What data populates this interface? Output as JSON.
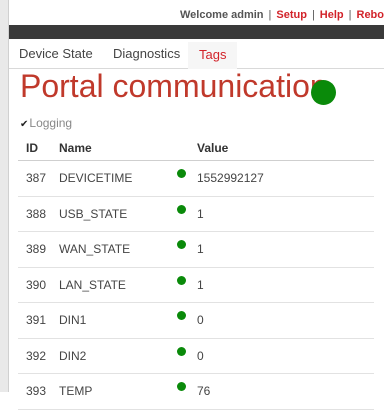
{
  "header": {
    "welcome": "Welcome admin",
    "links": [
      "Setup",
      "Help",
      "Rebo"
    ]
  },
  "tabs": [
    {
      "label": "Device State",
      "active": false
    },
    {
      "label": "Diagnostics",
      "active": false
    },
    {
      "label": "Tags",
      "active": true
    }
  ],
  "page": {
    "title": "Portal communication",
    "status_color": "#0a8a0a"
  },
  "logging": {
    "label": "Logging"
  },
  "table": {
    "columns": [
      "ID",
      "Name",
      "Value"
    ],
    "rows": [
      {
        "id": "387",
        "name": "DEVICETIME",
        "status": "green",
        "value": "1552992127"
      },
      {
        "id": "388",
        "name": "USB_STATE",
        "status": "green",
        "value": "1"
      },
      {
        "id": "389",
        "name": "WAN_STATE",
        "status": "green",
        "value": "1"
      },
      {
        "id": "390",
        "name": "LAN_STATE",
        "status": "green",
        "value": "1"
      },
      {
        "id": "391",
        "name": "DIN1",
        "status": "green",
        "value": "0"
      },
      {
        "id": "392",
        "name": "DIN2",
        "status": "green",
        "value": "0"
      },
      {
        "id": "393",
        "name": "TEMP",
        "status": "green",
        "value": "76"
      }
    ]
  },
  "colors": {
    "accent": "#d2232a",
    "status_ok": "#0a8a0a"
  }
}
